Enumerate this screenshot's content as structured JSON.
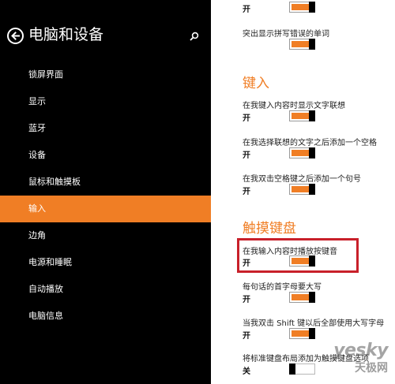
{
  "sidebar": {
    "title": "电脑和设备",
    "items": [
      {
        "label": "锁屏界面"
      },
      {
        "label": "显示"
      },
      {
        "label": "蓝牙"
      },
      {
        "label": "设备"
      },
      {
        "label": "鼠标和触摸板"
      },
      {
        "label": "输入"
      },
      {
        "label": "边角"
      },
      {
        "label": "电源和睡眠"
      },
      {
        "label": "自动播放"
      },
      {
        "label": "电脑信息"
      }
    ],
    "active_index": 5
  },
  "content": {
    "top_toggle": {
      "state_text": "开",
      "on": true
    },
    "highlight_misspelled": {
      "label": "突出显示拼写错误的单词",
      "state_text": "",
      "on": true
    },
    "typing_section": {
      "title": "键入",
      "settings": [
        {
          "label": "在我键入内容时显示文字联想",
          "state_text": "开",
          "on": true
        },
        {
          "label": "在我选择联想的文字之后添加一个空格",
          "state_text": "开",
          "on": true
        },
        {
          "label": "在我双击空格键之后添加一个句号",
          "state_text": "开",
          "on": true
        }
      ]
    },
    "touch_keyboard_section": {
      "title": "触摸键盘",
      "settings": [
        {
          "label": "在我输入内容时播放按键音",
          "state_text": "开",
          "on": true
        },
        {
          "label": "每句话的首字母要大写",
          "state_text": "开",
          "on": true
        },
        {
          "label": "当我双击 Shift 键以后全部使用大写字母",
          "state_text": "开",
          "on": true
        },
        {
          "label": "将标准键盘布局添加为触摸键盘选项",
          "state_text": "关",
          "on": false
        }
      ]
    }
  },
  "watermark": {
    "brand": "yesky",
    "sub": "天极网"
  },
  "colors": {
    "accent": "#f07e25",
    "highlight_border": "#c8202a",
    "sidebar_bg": "#000000"
  },
  "icons": {
    "back": "back-arrow-circle-icon",
    "search": "search-icon"
  }
}
